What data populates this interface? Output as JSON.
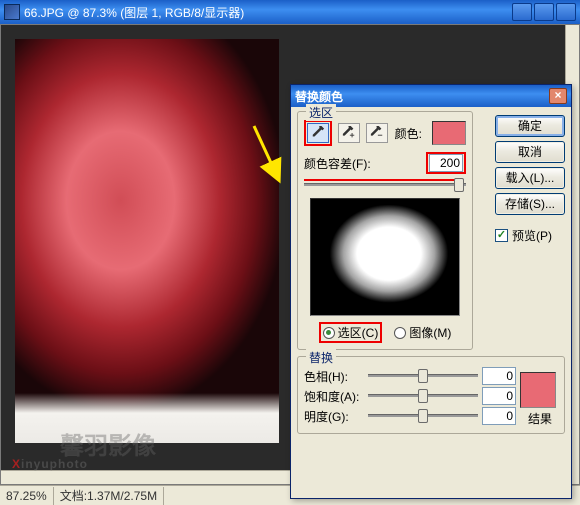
{
  "window": {
    "title": "66.JPG @ 87.3% (图层 1, RGB/8/显示器)",
    "zoom_status": "87.25%",
    "doc_status": "文档:1.37M/2.75M"
  },
  "dialog": {
    "title": "替换颜色",
    "buttons": {
      "ok": "确定",
      "cancel": "取消",
      "load": "载入(L)...",
      "save": "存储(S)..."
    },
    "preview_checkbox": "预览(P)",
    "preview_checked": true,
    "selection": {
      "group_title": "选区",
      "color_label": "颜色:",
      "color_swatch": "#e86a74",
      "fuzziness_label": "颜色容差(F):",
      "fuzziness_value": "200",
      "radio_selection": "选区(C)",
      "radio_image": "图像(M)",
      "radio_value": "selection"
    },
    "replace": {
      "group_title": "替换",
      "hue_label": "色相(H):",
      "hue_value": "0",
      "sat_label": "饱和度(A):",
      "sat_value": "0",
      "light_label": "明度(G):",
      "light_value": "0",
      "result_label": "结果",
      "result_swatch": "#e86a74"
    }
  },
  "watermark": {
    "en": "inyuphoto",
    "prefix": "X",
    "cn": "馨羽影像"
  }
}
